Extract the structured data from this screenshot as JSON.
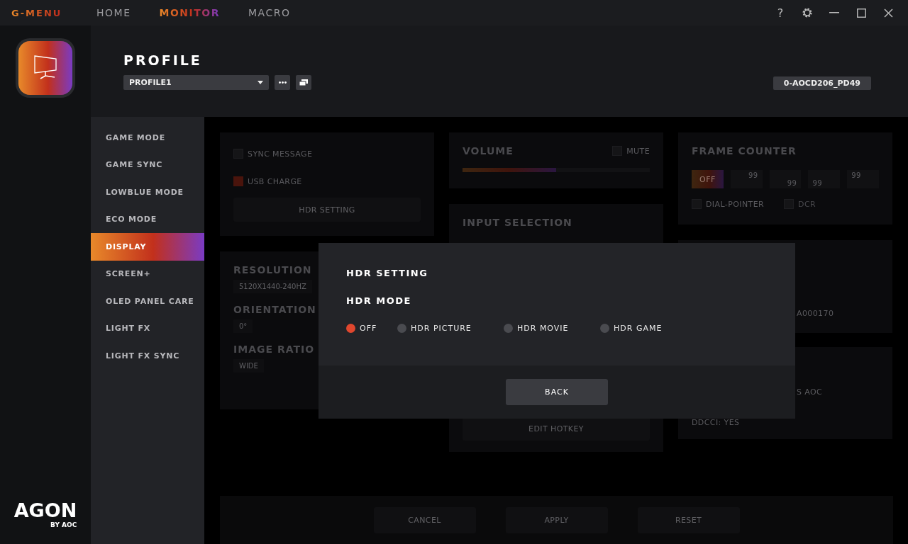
{
  "brand": "G-MENU",
  "tabs": [
    {
      "label": "HOME",
      "selected": false
    },
    {
      "label": "MONITOR",
      "selected": true
    },
    {
      "label": "MACRO",
      "selected": false
    }
  ],
  "help_label": "?",
  "logo": {
    "wordmark": "AGON",
    "byline": "BY AOC"
  },
  "profile": {
    "title": "PROFILE",
    "selected_profile": "PROFILE1",
    "device_id": "0-AOCD206_PD49"
  },
  "nav": [
    {
      "label": "GAME MODE",
      "selected": false
    },
    {
      "label": "GAME SYNC",
      "selected": false
    },
    {
      "label": "LOWBLUE MODE",
      "selected": false
    },
    {
      "label": "ECO MODE",
      "selected": false
    },
    {
      "label": "DISPLAY",
      "selected": true
    },
    {
      "label": "SCREEN+",
      "selected": false
    },
    {
      "label": "OLED PANEL CARE",
      "selected": false
    },
    {
      "label": "LIGHT FX",
      "selected": false
    },
    {
      "label": "LIGHT FX SYNC",
      "selected": false
    }
  ],
  "settings": {
    "options": [
      {
        "label": "SYNC MESSAGE",
        "checked": false
      },
      {
        "label": "USB CHARGE",
        "checked": true
      }
    ],
    "hdr_button": "HDR SETTING"
  },
  "display_card": [
    {
      "label": "RESOLUTION",
      "value": "5120X1440-240HZ"
    },
    {
      "label": "ORIENTATION",
      "value": "0°"
    },
    {
      "label": "IMAGE RATIO",
      "value": "WIDE"
    }
  ],
  "volume": {
    "title": "VOLUME",
    "mute_label": "MUTE",
    "muted": false,
    "level": 0.5
  },
  "input_selection": {
    "title": "INPUT SELECTION",
    "edit_hotkey": "EDIT HOTKEY"
  },
  "frame_counter": {
    "title": "FRAME COUNTER",
    "toggle": "OFF",
    "fields": [
      "99",
      "99",
      "99",
      "99"
    ],
    "options": [
      {
        "label": "DIAL-POINTER",
        "checked": false
      },
      {
        "label": "DCR",
        "checked": false
      }
    ]
  },
  "info_card": {
    "text": "A000170"
  },
  "info_card_2": {
    "lines": [
      "S AOC",
      "DDCCI: YES"
    ]
  },
  "footer_buttons": [
    "CANCEL",
    "APPLY",
    "RESET"
  ],
  "modal": {
    "title": "HDR SETTING",
    "section": "HDR MODE",
    "options": [
      {
        "label": "OFF",
        "selected": true
      },
      {
        "label": "HDR PICTURE",
        "selected": false
      },
      {
        "label": "HDR MOVIE",
        "selected": false
      },
      {
        "label": "HDR GAME",
        "selected": false
      }
    ],
    "back": "BACK"
  }
}
